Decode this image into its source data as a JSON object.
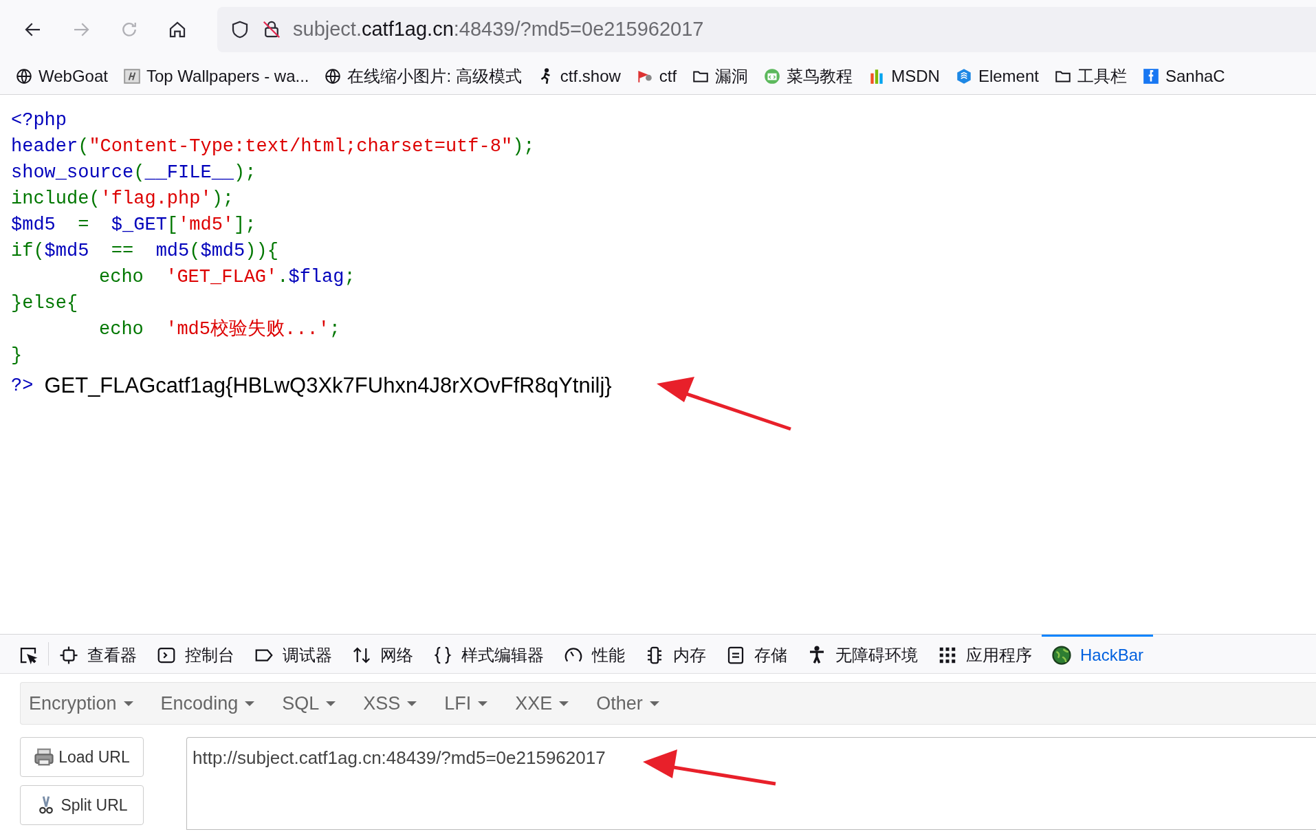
{
  "nav_buttons": [
    {
      "kind": "back",
      "disabled": false
    },
    {
      "kind": "forward",
      "disabled": true
    },
    {
      "kind": "reload",
      "disabled": true
    },
    {
      "kind": "home",
      "disabled": false
    }
  ],
  "address": {
    "subdomain": "subject.",
    "domain": "catf1ag.cn",
    "path": ":48439/?md5=0e215962017"
  },
  "bookmarks": [
    {
      "label": "WebGoat",
      "kind": "globe"
    },
    {
      "label": "Top Wallpapers - wa...",
      "kind": "tile"
    },
    {
      "label": "在线缩小图片: 高级模式",
      "kind": "globe"
    },
    {
      "label": "ctf.show",
      "kind": "figure"
    },
    {
      "label": "ctf",
      "kind": "flag"
    },
    {
      "label": "漏洞",
      "kind": "folder"
    },
    {
      "label": "菜鸟教程",
      "kind": "circle"
    },
    {
      "label": "MSDN",
      "kind": "bars"
    },
    {
      "label": "Element",
      "kind": "hexagon"
    },
    {
      "label": "工具栏",
      "kind": "folder"
    },
    {
      "label": "SanhaC",
      "kind": "square"
    }
  ],
  "code": {
    "lines": [
      {
        "indent": false,
        "tokens": [
          {
            "kind": "default",
            "text": "<?php"
          }
        ]
      },
      {
        "indent": false,
        "tokens": [
          {
            "kind": "default",
            "text": "header"
          },
          {
            "kind": "keyword",
            "text": "("
          },
          {
            "kind": "string",
            "text": "\"Content-Type:text/html;charset=utf-8\""
          },
          {
            "kind": "keyword",
            "text": ");"
          }
        ]
      },
      {
        "indent": false,
        "tokens": [
          {
            "kind": "default",
            "text": "show_source"
          },
          {
            "kind": "keyword",
            "text": "("
          },
          {
            "kind": "default",
            "text": "__FILE__"
          },
          {
            "kind": "keyword",
            "text": ");"
          }
        ]
      },
      {
        "indent": false,
        "tokens": [
          {
            "kind": "keyword",
            "text": "include("
          },
          {
            "kind": "string",
            "text": "'flag.php'"
          },
          {
            "kind": "keyword",
            "text": ");"
          }
        ]
      },
      {
        "indent": false,
        "tokens": [
          {
            "kind": "default",
            "text": "$md5  "
          },
          {
            "kind": "keyword",
            "text": "=  "
          },
          {
            "kind": "default",
            "text": "$_GET"
          },
          {
            "kind": "keyword",
            "text": "["
          },
          {
            "kind": "string",
            "text": "'md5'"
          },
          {
            "kind": "keyword",
            "text": "];"
          }
        ]
      },
      {
        "indent": false,
        "tokens": [
          {
            "kind": "keyword",
            "text": "if("
          },
          {
            "kind": "default",
            "text": "$md5  "
          },
          {
            "kind": "keyword",
            "text": "==  "
          },
          {
            "kind": "default",
            "text": "md5"
          },
          {
            "kind": "keyword",
            "text": "("
          },
          {
            "kind": "default",
            "text": "$md5"
          },
          {
            "kind": "keyword",
            "text": ")){"
          }
        ]
      },
      {
        "indent": true,
        "tokens": [
          {
            "kind": "keyword",
            "text": "echo  "
          },
          {
            "kind": "string",
            "text": "'GET_FLAG'"
          },
          {
            "kind": "keyword",
            "text": "."
          },
          {
            "kind": "default",
            "text": "$flag"
          },
          {
            "kind": "keyword",
            "text": ";"
          }
        ]
      },
      {
        "indent": false,
        "tokens": [
          {
            "kind": "keyword",
            "text": "}else{"
          }
        ]
      },
      {
        "indent": true,
        "tokens": [
          {
            "kind": "keyword",
            "text": "echo  "
          },
          {
            "kind": "string",
            "text": "'md5校验失败...'"
          },
          {
            "kind": "keyword",
            "text": ";"
          }
        ]
      },
      {
        "indent": false,
        "tokens": [
          {
            "kind": "keyword",
            "text": "}"
          }
        ]
      }
    ],
    "close_tag": "?>",
    "output": "GET_FLAGcatf1ag{HBLwQ3Xk7FUhxn4J8rXOvFfR8qYtnilj}"
  },
  "devtools_tabs": [
    {
      "kind": "picker",
      "selected": false
    },
    {
      "label": "查看器",
      "kind": "chip",
      "selected": false
    },
    {
      "label": "控制台",
      "kind": "prompt",
      "selected": false
    },
    {
      "label": "调试器",
      "kind": "tag",
      "selected": false
    },
    {
      "label": "网络",
      "kind": "updown",
      "selected": false
    },
    {
      "label": "样式编辑器",
      "kind": "braces",
      "selected": false
    },
    {
      "label": "性能",
      "kind": "gauge",
      "selected": false
    },
    {
      "label": "内存",
      "kind": "memory",
      "selected": false
    },
    {
      "label": "存储",
      "kind": "storage",
      "selected": false
    },
    {
      "label": "无障碍环境",
      "kind": "person",
      "selected": false
    },
    {
      "label": "应用程序",
      "kind": "grid",
      "selected": false
    },
    {
      "label": "HackBar",
      "kind": "globe",
      "selected": true
    }
  ],
  "hackbar": {
    "menus": [
      "Encryption",
      "Encoding",
      "SQL",
      "XSS",
      "LFI",
      "XXE",
      "Other"
    ],
    "buttons": [
      {
        "label": "Load URL",
        "kind": "load"
      },
      {
        "label": "Split URL",
        "kind": "split"
      }
    ],
    "url_value": "http://subject.catf1ag.cn:48439/?md5=0e215962017"
  }
}
